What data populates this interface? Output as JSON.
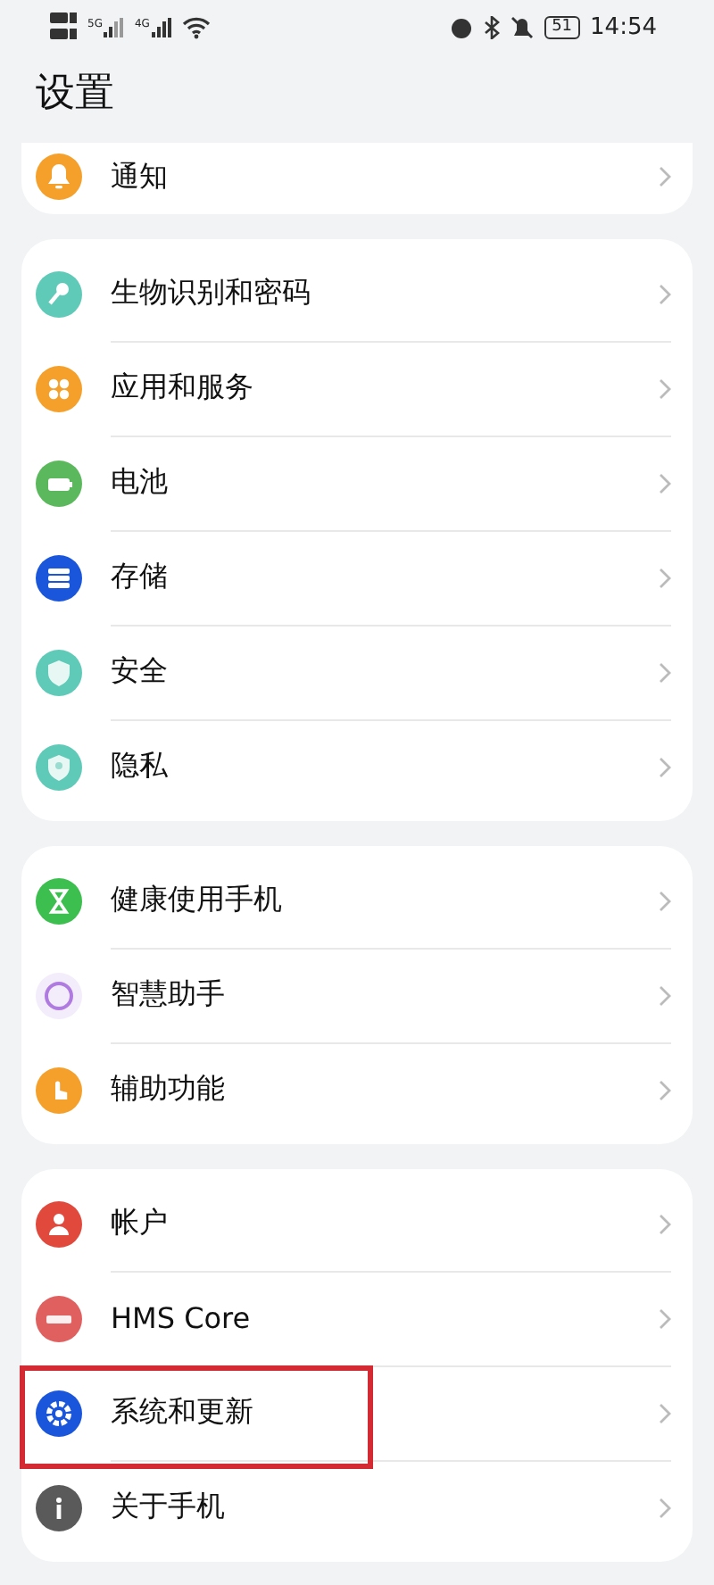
{
  "status_bar": {
    "network_1": "5G",
    "network_2": "4G",
    "battery": "51",
    "time": "14:54"
  },
  "header": {
    "title": "设置"
  },
  "groups": [
    {
      "items": [
        {
          "label": "通知",
          "kind": "bell",
          "color": "#f5a02a",
          "highlighted": false
        }
      ]
    },
    {
      "items": [
        {
          "label": "生物识别和密码",
          "kind": "key",
          "color": "#5fcab7",
          "highlighted": false
        },
        {
          "label": "应用和服务",
          "kind": "apps",
          "color": "#f5a02a",
          "highlighted": false
        },
        {
          "label": "电池",
          "kind": "battery",
          "color": "#5cb85c",
          "highlighted": false
        },
        {
          "label": "存储",
          "kind": "storage",
          "color": "#1a56db",
          "highlighted": false
        },
        {
          "label": "安全",
          "kind": "shield",
          "color": "#5fcab7",
          "highlighted": false
        },
        {
          "label": "隐私",
          "kind": "privacy",
          "color": "#5fcab7",
          "highlighted": false
        }
      ]
    },
    {
      "items": [
        {
          "label": "健康使用手机",
          "kind": "hourglass",
          "color": "#3cbf4e",
          "highlighted": false
        },
        {
          "label": "智慧助手",
          "kind": "ring",
          "color": "#b07be0",
          "highlighted": false
        },
        {
          "label": "辅助功能",
          "kind": "hand",
          "color": "#f5a02a",
          "highlighted": false
        }
      ]
    },
    {
      "items": [
        {
          "label": "帐户",
          "kind": "person",
          "color": "#e0493c",
          "highlighted": false
        },
        {
          "label": "HMS Core",
          "kind": "hms",
          "color": "#e06060",
          "highlighted": false
        },
        {
          "label": "系统和更新",
          "kind": "gear",
          "color": "#1a56db",
          "highlighted": true
        },
        {
          "label": "关于手机",
          "kind": "info",
          "color": "#5a5a5a",
          "highlighted": false
        }
      ]
    }
  ]
}
